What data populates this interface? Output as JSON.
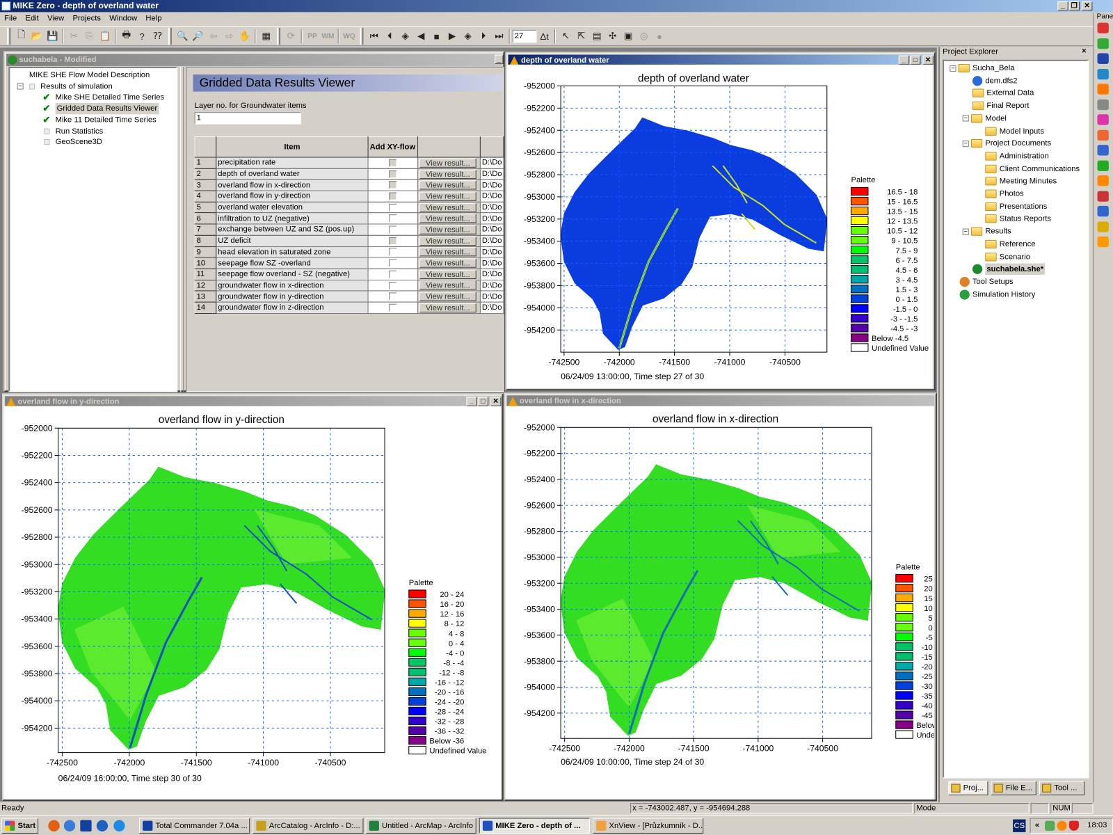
{
  "app": {
    "title": "MIKE Zero - depth of overland water"
  },
  "menu": [
    "File",
    "Edit",
    "View",
    "Projects",
    "Window",
    "Help"
  ],
  "toolbar": {
    "timestep_value": "27",
    "icons": [
      "new-file",
      "open-folder",
      "save",
      "cut",
      "copy",
      "paste",
      "print",
      "help",
      "context-help",
      "zoom-in",
      "zoom-out",
      "zoom-previous",
      "zoom-next",
      "pan-hand",
      "grid",
      "refresh",
      "pp",
      "wm",
      "wq",
      "first-frame",
      "previous-frame",
      "record-back",
      "step-back",
      "stop",
      "play",
      "record-forward",
      "next-frame",
      "last-frame",
      "delta-t",
      "select-arrow",
      "edit-arrow",
      "layers",
      "vector",
      "properties",
      "tool-a",
      "tool-b"
    ]
  },
  "model_window": {
    "title": "suchabela - Modified",
    "tree": [
      {
        "label": "MIKE SHE Flow Model Description",
        "level": 0,
        "mark": "none"
      },
      {
        "label": "Results of simulation",
        "level": 0,
        "mark": "square",
        "expander": "-"
      },
      {
        "label": "Mike SHE Detailed Time Series",
        "level": 1,
        "mark": "check"
      },
      {
        "label": "Gridded Data Results Viewer",
        "level": 1,
        "mark": "check",
        "selected": true
      },
      {
        "label": "Mike 11 Detailed Time Series",
        "level": 1,
        "mark": "check"
      },
      {
        "label": "Run Statistics",
        "level": 1,
        "mark": "square"
      },
      {
        "label": "GeoScene3D",
        "level": 1,
        "mark": "square"
      }
    ],
    "viewer": {
      "heading": "Gridded Data Results Viewer",
      "layer_label": "Layer no. for Groundwater items",
      "layer_value": "1",
      "columns": [
        "",
        "Item",
        "Add XY-flow vectors",
        "",
        ""
      ],
      "button_label": "View result...",
      "rows": [
        {
          "no": "1",
          "item": "precipitation rate",
          "enabled": false,
          "path": "D:\\Do"
        },
        {
          "no": "2",
          "item": "depth of overland water",
          "enabled": false,
          "path": "D:\\Do"
        },
        {
          "no": "3",
          "item": "overland flow in x-direction",
          "enabled": false,
          "path": "D:\\Do"
        },
        {
          "no": "4",
          "item": "overland flow in y-direction",
          "enabled": false,
          "path": "D:\\Do"
        },
        {
          "no": "5",
          "item": "overland water elevation",
          "enabled": true,
          "path": "D:\\Do"
        },
        {
          "no": "6",
          "item": "infiltration to UZ (negative)",
          "enabled": true,
          "path": "D:\\Do"
        },
        {
          "no": "7",
          "item": "exchange between UZ and SZ (pos.up)",
          "enabled": true,
          "path": "D:\\Do"
        },
        {
          "no": "8",
          "item": "UZ deficit",
          "enabled": false,
          "path": "D:\\Do"
        },
        {
          "no": "9",
          "item": "head elevation in saturated zone",
          "enabled": true,
          "path": "D:\\Do"
        },
        {
          "no": "10",
          "item": "seepage flow SZ -overland",
          "enabled": true,
          "path": "D:\\Do"
        },
        {
          "no": "11",
          "item": "seepage flow overland - SZ (negative)",
          "enabled": true,
          "path": "D:\\Do"
        },
        {
          "no": "12",
          "item": "groundwater flow in x-direction",
          "enabled": true,
          "path": "D:\\Do"
        },
        {
          "no": "13",
          "item": "groundwater flow in y-direction",
          "enabled": true,
          "path": "D:\\Do"
        },
        {
          "no": "14",
          "item": "groundwater flow in z-direction",
          "enabled": true,
          "path": "D:\\Do"
        }
      ]
    }
  },
  "chart_windows": [
    {
      "title": "depth of overland water",
      "active": true
    },
    {
      "title": "overland flow in y-direction",
      "active": false
    },
    {
      "title": "overland flow in x-direction",
      "active": false
    }
  ],
  "chart_data": [
    {
      "type": "heatmap",
      "title": "depth of overland water",
      "footer": "06/24/09 13:00:00, Time step 27 of 30",
      "xlim": [
        -742530,
        -740120
      ],
      "ylim": [
        -954400,
        -952000
      ],
      "grid": true,
      "xticks": [
        -742500,
        -742000,
        -741500,
        -741000,
        -740500
      ],
      "yticks": [
        -952000,
        -952200,
        -952400,
        -952600,
        -952800,
        -953000,
        -953200,
        -953400,
        -953600,
        -953800,
        -954000,
        -954200
      ],
      "base_color": "#0a3ce0",
      "river_color": "#c8e020",
      "legend": {
        "title": "Palette",
        "position": "right",
        "entries": [
          {
            "color": "#ff0000",
            "label": "16.5 -   18"
          },
          {
            "color": "#ff5500",
            "label": "15 - 16.5"
          },
          {
            "color": "#ffaa00",
            "label": "13.5 -   15"
          },
          {
            "color": "#ffff00",
            "label": "12 - 13.5"
          },
          {
            "color": "#66ff00",
            "label": "10.5 -   12"
          },
          {
            "color": "#66ff11",
            "label": "9 - 10.5"
          },
          {
            "color": "#00ff00",
            "label": "7.5 -     9"
          },
          {
            "color": "#00c466",
            "label": "6 -   7.5"
          },
          {
            "color": "#00c070",
            "label": "4.5 -     6"
          },
          {
            "color": "#00a8a8",
            "label": "3 -   4.5"
          },
          {
            "color": "#0070c0",
            "label": "1.5 -     3"
          },
          {
            "color": "#0040dd",
            "label": "0 -   1.5"
          },
          {
            "color": "#0000ff",
            "label": "-1.5 -     0"
          },
          {
            "color": "#3300cc",
            "label": "-3 -  -1.5"
          },
          {
            "color": "#5500aa",
            "label": "-4.5 -    -3"
          },
          {
            "color": "#880088",
            "label": "Below  -4.5"
          },
          {
            "color": "#ffffff",
            "label": "Undefined Value"
          }
        ]
      }
    },
    {
      "type": "heatmap",
      "title": "overland flow in y-direction",
      "footer": "06/24/09 16:00:00, Time step 30 of 30",
      "xlim": [
        -742530,
        -740095
      ],
      "ylim": [
        -954380,
        -952000
      ],
      "grid": true,
      "xticks": [
        -742500,
        -742000,
        -741500,
        -741000,
        -740500
      ],
      "yticks": [
        -952000,
        -952200,
        -952400,
        -952600,
        -952800,
        -953000,
        -953200,
        -953400,
        -953600,
        -953800,
        -954000,
        -954200
      ],
      "base_color": "#33dd22",
      "river_color": "#1050c0",
      "legend": {
        "title": "Palette",
        "position": "right",
        "entries": [
          {
            "color": "#ff0000",
            "label": "20 -  24"
          },
          {
            "color": "#ff5500",
            "label": "16 -  20"
          },
          {
            "color": "#ffaa00",
            "label": "12 -  16"
          },
          {
            "color": "#ffff00",
            "label": "8 -  12"
          },
          {
            "color": "#66ff00",
            "label": "4 -    8"
          },
          {
            "color": "#66ff11",
            "label": "0 -    4"
          },
          {
            "color": "#00ff00",
            "label": "-4 -    0"
          },
          {
            "color": "#00c466",
            "label": "-8 -   -4"
          },
          {
            "color": "#00c070",
            "label": "-12 -   -8"
          },
          {
            "color": "#00a8a8",
            "label": "-16 - -12"
          },
          {
            "color": "#0070c0",
            "label": "-20 - -16"
          },
          {
            "color": "#0040dd",
            "label": "-24 - -20"
          },
          {
            "color": "#0000ff",
            "label": "-28 - -24"
          },
          {
            "color": "#3300cc",
            "label": "-32 - -28"
          },
          {
            "color": "#5500aa",
            "label": "-36 - -32"
          },
          {
            "color": "#880088",
            "label": "Below  -36"
          },
          {
            "color": "#ffffff",
            "label": "Undefined Value"
          }
        ]
      }
    },
    {
      "type": "heatmap",
      "title": "overland flow in x-direction",
      "footer": "06/24/09 10:00:00, Time step 24 of 30",
      "xlim": [
        -742530,
        -740120
      ],
      "ylim": [
        -954395,
        -952000
      ],
      "grid": true,
      "xticks": [
        -742500,
        -742000,
        -741500,
        -741000,
        -740500
      ],
      "yticks": [
        -952000,
        -952200,
        -952400,
        -952600,
        -952800,
        -953000,
        -953200,
        -953400,
        -953600,
        -953800,
        -954000,
        -954200
      ],
      "base_color": "#33dd22",
      "river_color": "#1070b0",
      "legend": {
        "title": "Palette",
        "position": "right",
        "entries": [
          {
            "color": "#ff0000",
            "label": "25"
          },
          {
            "color": "#ff5500",
            "label": "20"
          },
          {
            "color": "#ffaa00",
            "label": "15"
          },
          {
            "color": "#ffff00",
            "label": "10"
          },
          {
            "color": "#66ff00",
            "label": "5"
          },
          {
            "color": "#66ff11",
            "label": "0"
          },
          {
            "color": "#00ff00",
            "label": "-5"
          },
          {
            "color": "#00c466",
            "label": "-10"
          },
          {
            "color": "#00c070",
            "label": "-15"
          },
          {
            "color": "#00a8a8",
            "label": "-20"
          },
          {
            "color": "#0070c0",
            "label": "-25"
          },
          {
            "color": "#0040dd",
            "label": "-30"
          },
          {
            "color": "#0000ff",
            "label": "-35"
          },
          {
            "color": "#3300cc",
            "label": "-40"
          },
          {
            "color": "#5500aa",
            "label": "-45"
          },
          {
            "color": "#880088",
            "label": "Below"
          },
          {
            "color": "#ffffff",
            "label": "Undefined Value"
          }
        ]
      }
    }
  ],
  "project_explorer": {
    "title": "Project Explorer",
    "items": [
      {
        "label": "Sucha_Bela",
        "level": 0,
        "icon": "folder",
        "expander": "-"
      },
      {
        "label": "dem.dfs2",
        "level": 1,
        "icon": "dfs2-file"
      },
      {
        "label": "External Data",
        "level": 1,
        "icon": "folder"
      },
      {
        "label": "Final Report",
        "level": 1,
        "icon": "folder"
      },
      {
        "label": "Model",
        "level": 1,
        "icon": "folder",
        "expander": "-"
      },
      {
        "label": "Model Inputs",
        "level": 2,
        "icon": "folder"
      },
      {
        "label": "Project Documents",
        "level": 1,
        "icon": "folder",
        "expander": "-"
      },
      {
        "label": "Administration",
        "level": 2,
        "icon": "folder"
      },
      {
        "label": "Client Communications",
        "level": 2,
        "icon": "folder"
      },
      {
        "label": "Meeting Minutes",
        "level": 2,
        "icon": "folder"
      },
      {
        "label": "Photos",
        "level": 2,
        "icon": "folder"
      },
      {
        "label": "Presentations",
        "level": 2,
        "icon": "folder"
      },
      {
        "label": "Status Reports",
        "level": 2,
        "icon": "folder"
      },
      {
        "label": "Results",
        "level": 1,
        "icon": "folder",
        "expander": "-"
      },
      {
        "label": "Reference",
        "level": 2,
        "icon": "folder"
      },
      {
        "label": "Scenario",
        "level": 2,
        "icon": "folder"
      },
      {
        "label": "suchabela.she*",
        "level": 1,
        "icon": "she-file",
        "selected": true
      },
      {
        "label": "Tool Setups",
        "level": 0,
        "icon": "tools"
      },
      {
        "label": "Simulation History",
        "level": 0,
        "icon": "history"
      }
    ],
    "tabs": [
      "Proj...",
      "File E...",
      "Tool ..."
    ]
  },
  "side_strip": {
    "label": "Pane"
  },
  "status": {
    "ready": "Ready",
    "coords": "x = -743002.487, y = -954694.288",
    "mode": "Mode",
    "blank": "",
    "num": "NUM"
  },
  "taskbar": {
    "start": "Start",
    "tasks": [
      "Total Commander 7.04a ...",
      "ArcCatalog - ArcInfo - D:...",
      "Untitled - ArcMap - ArcInfo",
      "MIKE Zero - depth of ...",
      "XnView - [Průzkumník - D..."
    ],
    "active_task": 3,
    "lang": "CS",
    "tray_expand": "«",
    "clock": "18:03"
  }
}
